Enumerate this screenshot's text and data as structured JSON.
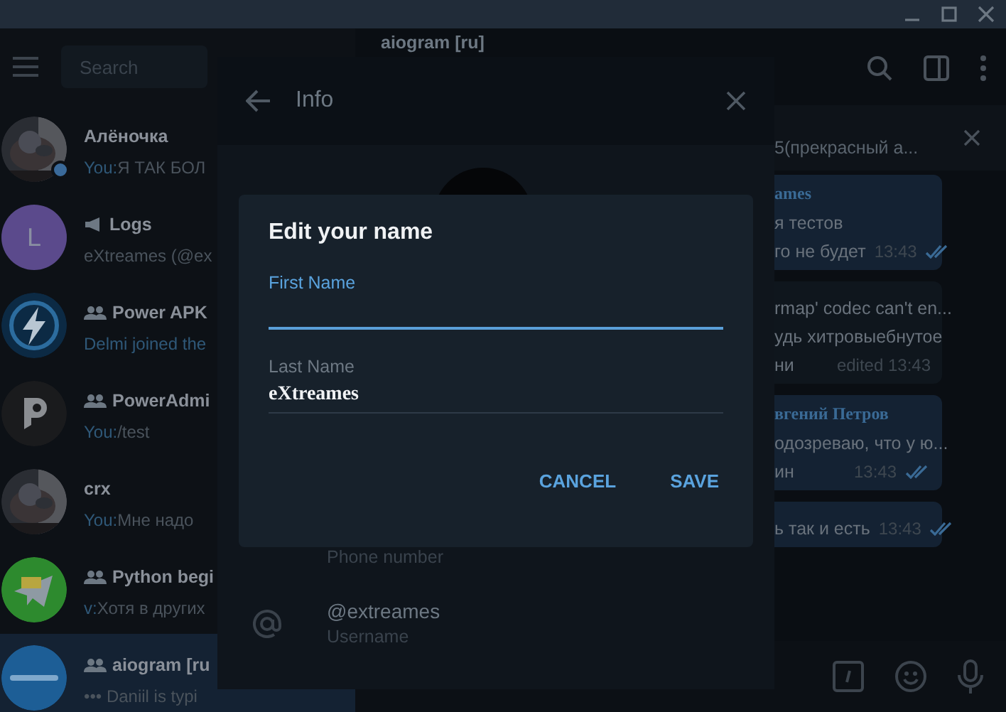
{
  "search": {
    "placeholder": "Search"
  },
  "chats": [
    {
      "name": "Алёночка",
      "kind": "private",
      "online": true,
      "selected": false,
      "sender": "You:",
      "text": "Я ТАК БОЛ",
      "service": false
    },
    {
      "name": "Logs",
      "kind": "channel",
      "avatar": {
        "kind": "letter",
        "letter": "L",
        "color": "#5b4a8c"
      },
      "online": false,
      "selected": false,
      "text": "eXtreames (@ex",
      "service": false
    },
    {
      "name": "Power APK",
      "kind": "group",
      "avatar": {
        "kind": "lightning"
      },
      "online": false,
      "selected": false,
      "text": "Delmi joined the",
      "service": true
    },
    {
      "name": "PowerAdmi",
      "kind": "group",
      "avatar": {
        "kind": "p-logo"
      },
      "online": false,
      "selected": false,
      "sender": "You:",
      "text": "/test",
      "service": false
    },
    {
      "name": "crx",
      "kind": "private",
      "online": false,
      "selected": false,
      "sender": "You:",
      "text": "Мне надо",
      "service": false
    },
    {
      "name": "Python begi",
      "kind": "group",
      "avatar": {
        "kind": "plane"
      },
      "online": false,
      "selected": false,
      "sender": "v:",
      "text": "Хотя в других",
      "service": false
    },
    {
      "name": "aiogram [ru",
      "kind": "group",
      "avatar": {
        "kind": "aiogram"
      },
      "online": false,
      "selected": true,
      "text": "••• Daniil is typi",
      "service": false
    }
  ],
  "chat": {
    "title": "aiogram [ru]",
    "pinned": "5(прекрасный а...",
    "messages": [
      {
        "outgoing": true,
        "author": "ames",
        "lines": [
          "я тестов",
          "го не будет"
        ],
        "time": "13:43",
        "read": true
      },
      {
        "outgoing": false,
        "lines": [
          "rmap' codec can't en...",
          "удь хитровыебнутое",
          "ни"
        ],
        "time": "edited 13:43",
        "read": false
      },
      {
        "outgoing": true,
        "author": "вгений Петров",
        "lines": [
          "одозреваю, что у ю...",
          "ин"
        ],
        "time": "13:43",
        "read": true
      },
      {
        "outgoing": true,
        "lines": [
          "ь так и есть"
        ],
        "time": "13:43",
        "read": true
      }
    ]
  },
  "info": {
    "title": "Info",
    "fields": [
      {
        "kind": "phone",
        "label": "Phone number"
      },
      {
        "kind": "username",
        "value": "@extreames",
        "label": "Username"
      }
    ]
  },
  "dialog": {
    "title": "Edit your name",
    "first_name": {
      "label": "First Name",
      "focused": true
    },
    "last_name": {
      "label": "Last Name",
      "value": "eXtreames",
      "focused": false
    },
    "buttons": [
      "CANCEL",
      "SAVE"
    ]
  }
}
